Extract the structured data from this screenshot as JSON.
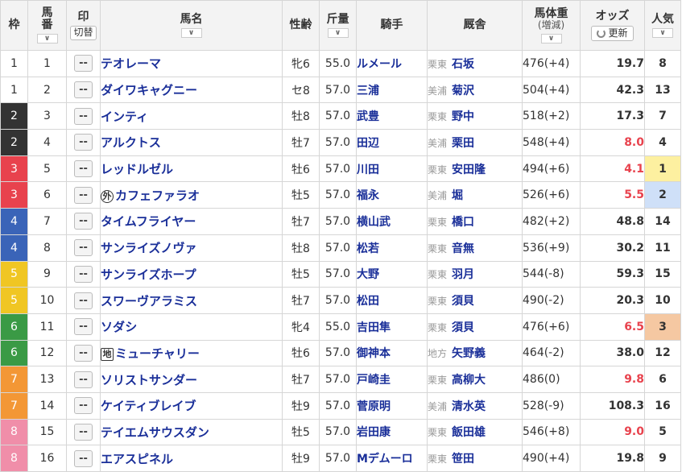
{
  "headers": {
    "waku": "枠",
    "umaban": "馬番",
    "mark": "印",
    "mark_toggle": "切替",
    "horse": "馬名",
    "sexage": "性齢",
    "weight": "斤量",
    "jockey": "騎手",
    "stable": "厩舎",
    "body_weight": "馬体重",
    "body_weight_sub": "(増減)",
    "odds": "オッズ",
    "refresh": "更新",
    "popularity": "人気"
  },
  "waku_colors": {
    "1": {
      "bg": "#ffffff",
      "fg": "#333333"
    },
    "2": {
      "bg": "#333333",
      "fg": "#ffffff"
    },
    "3": {
      "bg": "#e8424d",
      "fg": "#ffffff"
    },
    "4": {
      "bg": "#3a64b8",
      "fg": "#ffffff"
    },
    "5": {
      "bg": "#f0c623",
      "fg": "#ffffff"
    },
    "6": {
      "bg": "#3a9a45",
      "fg": "#ffffff"
    },
    "7": {
      "bg": "#f39735",
      "fg": "#ffffff"
    },
    "8": {
      "bg": "#f08ea9",
      "fg": "#ffffff"
    }
  },
  "odds_highlight_color": "#e8424d",
  "popularity_colors": {
    "1": "#fdf0a0",
    "2": "#cfe0f8",
    "3": "#f5c8a2"
  },
  "mark_placeholder": "--",
  "rows": [
    {
      "waku": "1",
      "umaban": "1",
      "tag": "",
      "horse": "テオレーマ",
      "sexage": "牝6",
      "weight": "55.0",
      "jockey": "ルメール",
      "region": "栗東",
      "trainer": "石坂",
      "body_weight": "476(+4)",
      "odds": "19.7",
      "popularity": "8"
    },
    {
      "waku": "1",
      "umaban": "2",
      "tag": "",
      "horse": "ダイワキャグニー",
      "sexage": "セ8",
      "weight": "57.0",
      "jockey": "三浦",
      "region": "美浦",
      "trainer": "菊沢",
      "body_weight": "504(+4)",
      "odds": "42.3",
      "popularity": "13"
    },
    {
      "waku": "2",
      "umaban": "3",
      "tag": "",
      "horse": "インティ",
      "sexage": "牡8",
      "weight": "57.0",
      "jockey": "武豊",
      "region": "栗東",
      "trainer": "野中",
      "body_weight": "518(+2)",
      "odds": "17.3",
      "popularity": "7"
    },
    {
      "waku": "2",
      "umaban": "4",
      "tag": "",
      "horse": "アルクトス",
      "sexage": "牡7",
      "weight": "57.0",
      "jockey": "田辺",
      "region": "美浦",
      "trainer": "栗田",
      "body_weight": "548(+4)",
      "odds": "8.0",
      "popularity": "4"
    },
    {
      "waku": "3",
      "umaban": "5",
      "tag": "",
      "horse": "レッドルゼル",
      "sexage": "牡6",
      "weight": "57.0",
      "jockey": "川田",
      "region": "栗東",
      "trainer": "安田隆",
      "body_weight": "494(+6)",
      "odds": "4.1",
      "popularity": "1"
    },
    {
      "waku": "3",
      "umaban": "6",
      "tag": "外",
      "horse": "カフェファラオ",
      "sexage": "牡5",
      "weight": "57.0",
      "jockey": "福永",
      "region": "美浦",
      "trainer": "堀",
      "body_weight": "526(+6)",
      "odds": "5.5",
      "popularity": "2"
    },
    {
      "waku": "4",
      "umaban": "7",
      "tag": "",
      "horse": "タイムフライヤー",
      "sexage": "牡7",
      "weight": "57.0",
      "jockey": "横山武",
      "region": "栗東",
      "trainer": "橋口",
      "body_weight": "482(+2)",
      "odds": "48.8",
      "popularity": "14"
    },
    {
      "waku": "4",
      "umaban": "8",
      "tag": "",
      "horse": "サンライズノヴァ",
      "sexage": "牡8",
      "weight": "57.0",
      "jockey": "松若",
      "region": "栗東",
      "trainer": "音無",
      "body_weight": "536(+9)",
      "odds": "30.2",
      "popularity": "11"
    },
    {
      "waku": "5",
      "umaban": "9",
      "tag": "",
      "horse": "サンライズホープ",
      "sexage": "牡5",
      "weight": "57.0",
      "jockey": "大野",
      "region": "栗東",
      "trainer": "羽月",
      "body_weight": "544(-8)",
      "odds": "59.3",
      "popularity": "15"
    },
    {
      "waku": "5",
      "umaban": "10",
      "tag": "",
      "horse": "スワーヴアラミス",
      "sexage": "牡7",
      "weight": "57.0",
      "jockey": "松田",
      "region": "栗東",
      "trainer": "須貝",
      "body_weight": "490(-2)",
      "odds": "20.3",
      "popularity": "10"
    },
    {
      "waku": "6",
      "umaban": "11",
      "tag": "",
      "horse": "ソダシ",
      "sexage": "牝4",
      "weight": "55.0",
      "jockey": "吉田隼",
      "region": "栗東",
      "trainer": "須貝",
      "body_weight": "476(+6)",
      "odds": "6.5",
      "popularity": "3"
    },
    {
      "waku": "6",
      "umaban": "12",
      "tag": "地",
      "horse": "ミューチャリー",
      "sexage": "牡6",
      "weight": "57.0",
      "jockey": "御神本",
      "region": "地方",
      "trainer": "矢野義",
      "body_weight": "464(-2)",
      "odds": "38.0",
      "popularity": "12"
    },
    {
      "waku": "7",
      "umaban": "13",
      "tag": "",
      "horse": "ソリストサンダー",
      "sexage": "牡7",
      "weight": "57.0",
      "jockey": "戸崎圭",
      "region": "栗東",
      "trainer": "高柳大",
      "body_weight": "486(0)",
      "odds": "9.8",
      "popularity": "6"
    },
    {
      "waku": "7",
      "umaban": "14",
      "tag": "",
      "horse": "ケイティブレイブ",
      "sexage": "牡9",
      "weight": "57.0",
      "jockey": "菅原明",
      "region": "美浦",
      "trainer": "清水英",
      "body_weight": "528(-9)",
      "odds": "108.3",
      "popularity": "16"
    },
    {
      "waku": "8",
      "umaban": "15",
      "tag": "",
      "horse": "テイエムサウスダン",
      "sexage": "牡5",
      "weight": "57.0",
      "jockey": "岩田康",
      "region": "栗東",
      "trainer": "飯田雄",
      "body_weight": "546(+8)",
      "odds": "9.0",
      "popularity": "5"
    },
    {
      "waku": "8",
      "umaban": "16",
      "tag": "",
      "horse": "エアスピネル",
      "sexage": "牡9",
      "weight": "57.0",
      "jockey": "Mデムーロ",
      "region": "栗東",
      "trainer": "笹田",
      "body_weight": "490(+4)",
      "odds": "19.8",
      "popularity": "9"
    }
  ]
}
